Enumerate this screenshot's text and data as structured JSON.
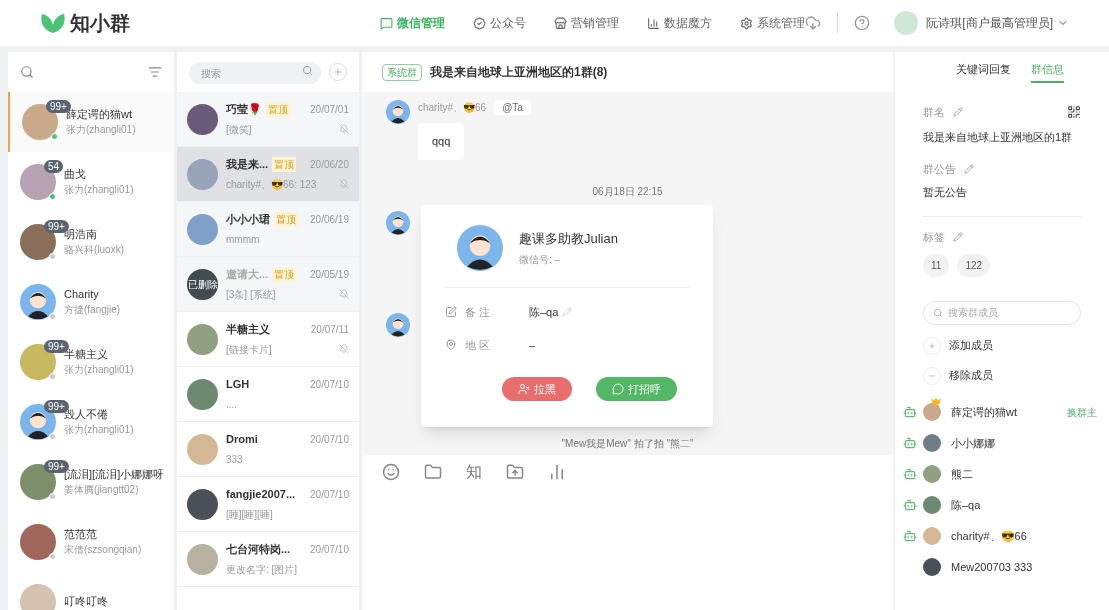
{
  "header": {
    "logo": "知小群",
    "nav": [
      {
        "label": "微信管理",
        "selected": true
      },
      {
        "label": "公众号",
        "selected": false
      },
      {
        "label": "营销管理",
        "selected": false
      },
      {
        "label": "数据魔方",
        "selected": false
      },
      {
        "label": "系统管理",
        "selected": false
      }
    ],
    "user": "阮诗琪[商户最高管理员]"
  },
  "accounts": [
    {
      "name": "薛定谔的猫wt",
      "sub": "张力(zhangli01)",
      "badge": "99+",
      "online": true,
      "selected": true
    },
    {
      "name": "曲戈",
      "sub": "张力(zhangli01)",
      "badge": "54",
      "online": true,
      "selected": false
    },
    {
      "name": "明浩南",
      "sub": "骆兴科(luoxk)",
      "badge": "99+",
      "online": false,
      "selected": false
    },
    {
      "name": "Charity",
      "sub": "方捷(fangjie)",
      "online": false,
      "selected": false
    },
    {
      "name": "半糖主义",
      "sub": "张力(zhangli01)",
      "badge": "99+",
      "online": false,
      "selected": false
    },
    {
      "name": "毁人不倦",
      "sub": "张力(zhangli01)",
      "badge": "99+",
      "online": false,
      "selected": false
    },
    {
      "name": "[流泪][流泪]小娜娜呀",
      "sub": "姜体腾(jiangtt02)",
      "badge": "99+",
      "online": false,
      "selected": false
    },
    {
      "name": "范范范",
      "sub": "宋倩(szsongqian)",
      "online": false,
      "selected": false
    },
    {
      "name": "叮咚叮咚",
      "selected": false
    }
  ],
  "chat_search": {
    "placeholder": "搜索"
  },
  "chats": [
    {
      "name": "巧莹🌹",
      "pin_tag": "置顶",
      "time": "20/07/01",
      "preview": "[微笑]",
      "muted": true,
      "selected": false
    },
    {
      "name": "我是来...",
      "pin_tag": "置顶",
      "time": "20/06/20",
      "preview": "charity#、😎66:  123",
      "muted": true,
      "selected": true
    },
    {
      "name": "小小小珺",
      "pin_tag": "置顶",
      "time": "20/06/19",
      "preview": "mmmm",
      "muted": false,
      "selected": false
    },
    {
      "name": "邀请大...",
      "pin_tag": "置顶",
      "time": "20/05/19",
      "preview": "[3条] [系统]",
      "muted": true,
      "selected": false,
      "deleted": "已删除"
    },
    {
      "name": "半糖主义",
      "time": "20/07/11",
      "preview": "[链接卡片]",
      "muted": true,
      "selected": false
    },
    {
      "name": "LGH",
      "time": "20/07/10",
      "preview": "....",
      "muted": false,
      "selected": false
    },
    {
      "name": "Dromi",
      "time": "20/07/10",
      "preview": "333",
      "muted": false,
      "selected": false
    },
    {
      "name": "fangjie2007...",
      "time": "20/07/10",
      "preview": "[睡][睡][睡]",
      "muted": false,
      "selected": false
    },
    {
      "name": "七台河特岗...",
      "time": "20/07/10",
      "preview": "更改名字: [图片]",
      "muted": false,
      "selected": false
    }
  ],
  "conversation": {
    "tag": "系统群",
    "title": "我是来自地球上亚洲地区的1群(8)",
    "message": {
      "sender": "charity#、😎66",
      "mention": "@Ta",
      "text": "qqq"
    },
    "timestamp": "06月18日 22:15",
    "system_note": "\"Mew我是Mew\" 拍了拍 \"熊二\"",
    "toolbar_text": "知"
  },
  "profile_popup": {
    "name": "趣课多助教Julian",
    "wechat_id": "微信号: –",
    "remark_label": "备 注",
    "remark": "陈–qa",
    "region_label": "地 区",
    "region": "–",
    "block_button": "拉黑",
    "greet_button": "打招呼"
  },
  "info_panel": {
    "tabs": [
      {
        "label": "关键词回复",
        "selected": false
      },
      {
        "label": "群信息",
        "selected": true
      }
    ],
    "group_name_label": "群名",
    "group_name": "我是来自地球上亚洲地区的1群",
    "notice_label": "群公告",
    "notice": "暂无公告",
    "tags_label": "标签",
    "tags": [
      "11",
      "122"
    ],
    "member_search": {
      "placeholder": "搜索群成员"
    },
    "add_member": "添加成员",
    "remove_member": "移除成员",
    "members": [
      {
        "name": "薛定谔的猫wt",
        "bot": true,
        "owner": true,
        "action": "换群主"
      },
      {
        "name": "小小娜娜",
        "bot": true,
        "owner": false
      },
      {
        "name": "熊二",
        "bot": true,
        "owner": false
      },
      {
        "name": "陈–qa",
        "bot": true,
        "owner": false
      },
      {
        "name": "charity#、😎66",
        "bot": true,
        "owner": false
      },
      {
        "name": "Mew200703 333",
        "bot": false,
        "owner": false
      }
    ]
  }
}
